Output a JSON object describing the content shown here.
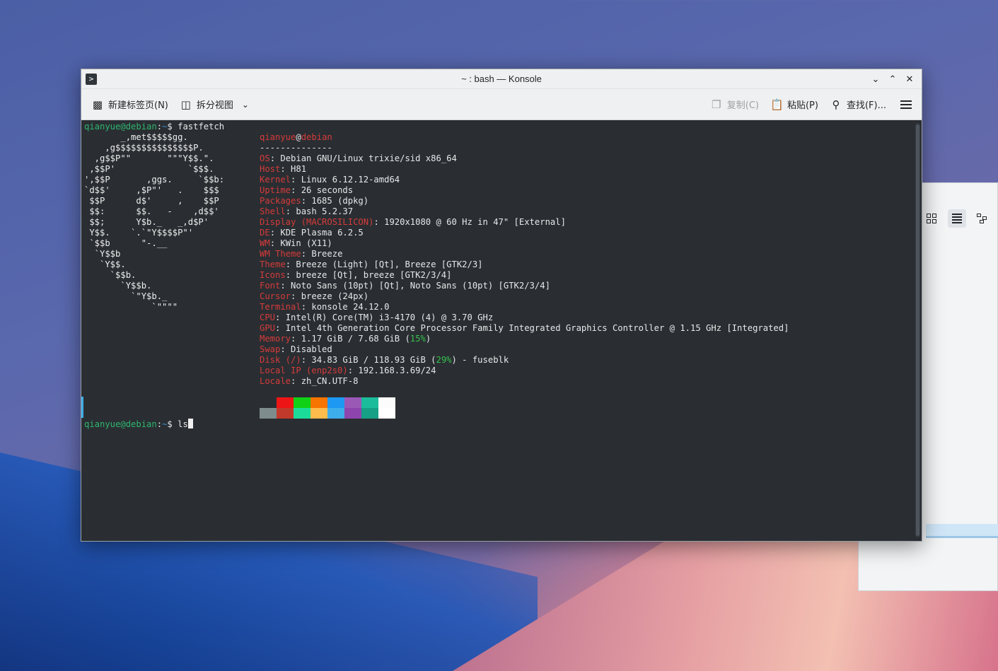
{
  "window": {
    "title": "~ : bash — Konsole",
    "app_icon": "terminal-prompt-icon",
    "controls": [
      "minimize-icon",
      "maximize-icon",
      "close-icon"
    ]
  },
  "toolbar": {
    "new_tab": "新建标签页(N)",
    "split_view": "拆分视图",
    "copy": "复制(C)",
    "paste": "粘贴(P)",
    "find": "查找(F)..."
  },
  "terminal": {
    "prompt_user": "qianyue@debian",
    "prompt_path": "~",
    "prompt_symbol": "$",
    "command1": "fastfetch",
    "command2": "ls",
    "logo": [
      "       _,met$$$$$gg.",
      "    ,g$$$$$$$$$$$$$$$P.",
      "  ,g$$P\"\"       \"\"\"Y$$.\".",
      " ,$$P'              `$$$.",
      "',$$P       ,ggs.     `$$b:",
      "`d$$'     ,$P\"'   .    $$$",
      " $$P      d$'     ,    $$P",
      " $$:      $$.   -    ,d$$'",
      " $$;      Y$b._   _,d$P'",
      " Y$$.    `.`\"Y$$$$P\"'",
      " `$$b      \"-.__",
      "  `Y$$b",
      "   `Y$$.",
      "     `$$b.",
      "       `Y$$b.",
      "         `\"Y$b._",
      "             `\"\"\"\""
    ],
    "info_user": "qianyue",
    "info_at": "@",
    "info_host": "debian",
    "separator": "--------------",
    "info": [
      {
        "key": "OS",
        "value": ": Debian GNU/Linux trixie/sid x86_64"
      },
      {
        "key": "Host",
        "value": ": H81"
      },
      {
        "key": "Kernel",
        "value": ": Linux 6.12.12-amd64"
      },
      {
        "key": "Uptime",
        "value": ": 26 seconds"
      },
      {
        "key": "Packages",
        "value": ": 1685 (dpkg)"
      },
      {
        "key": "Shell",
        "value": ": bash 5.2.37"
      },
      {
        "key": "Display (MACROSILICON)",
        "value": ": 1920x1080 @ 60 Hz in 47\" [External]"
      },
      {
        "key": "DE",
        "value": ": KDE Plasma 6.2.5"
      },
      {
        "key": "WM",
        "value": ": KWin (X11)"
      },
      {
        "key": "WM Theme",
        "value": ": Breeze"
      },
      {
        "key": "Theme",
        "value": ": Breeze (Light) [Qt], Breeze [GTK2/3]"
      },
      {
        "key": "Icons",
        "value": ": breeze [Qt], breeze [GTK2/3/4]"
      },
      {
        "key": "Font",
        "value": ": Noto Sans (10pt) [Qt], Noto Sans (10pt) [GTK2/3/4]"
      },
      {
        "key": "Cursor",
        "value": ": breeze (24px)"
      },
      {
        "key": "Terminal",
        "value": ": konsole 24.12.0"
      },
      {
        "key": "CPU",
        "value": ": Intel(R) Core(TM) i3-4170 (4) @ 3.70 GHz"
      },
      {
        "key": "GPU",
        "value": ": Intel 4th Generation Core Processor Family Integrated Graphics Controller @ 1.15 GHz [Integrated]"
      },
      {
        "key": "Locale",
        "value": ": zh_CN.UTF-8"
      }
    ],
    "memory": {
      "key": "Memory",
      "pre": ": 1.17 GiB / 7.68 GiB (",
      "pct": "15%",
      "post": ")"
    },
    "swap": {
      "key": "Swap",
      "value": ": Disabled"
    },
    "disk": {
      "key": "Disk (/)",
      "pre": ": 34.83 GiB / 118.93 GiB (",
      "pct": "29%",
      "post": ") - fuseblk"
    },
    "local_ip": {
      "key": "Local IP (enp2s0)",
      "value": ": 192.168.3.69/24"
    },
    "palette_top": [
      "#2a2e32",
      "#ed1515",
      "#11d116",
      "#f67400",
      "#1d99f3",
      "#9b59b6",
      "#1abc9c",
      "#fcfcfc"
    ],
    "palette_bottom": [
      "#7f8c8d",
      "#c0392b",
      "#1cdc9a",
      "#fdbc4b",
      "#3daee9",
      "#8e44ad",
      "#16a085",
      "#ffffff"
    ]
  }
}
